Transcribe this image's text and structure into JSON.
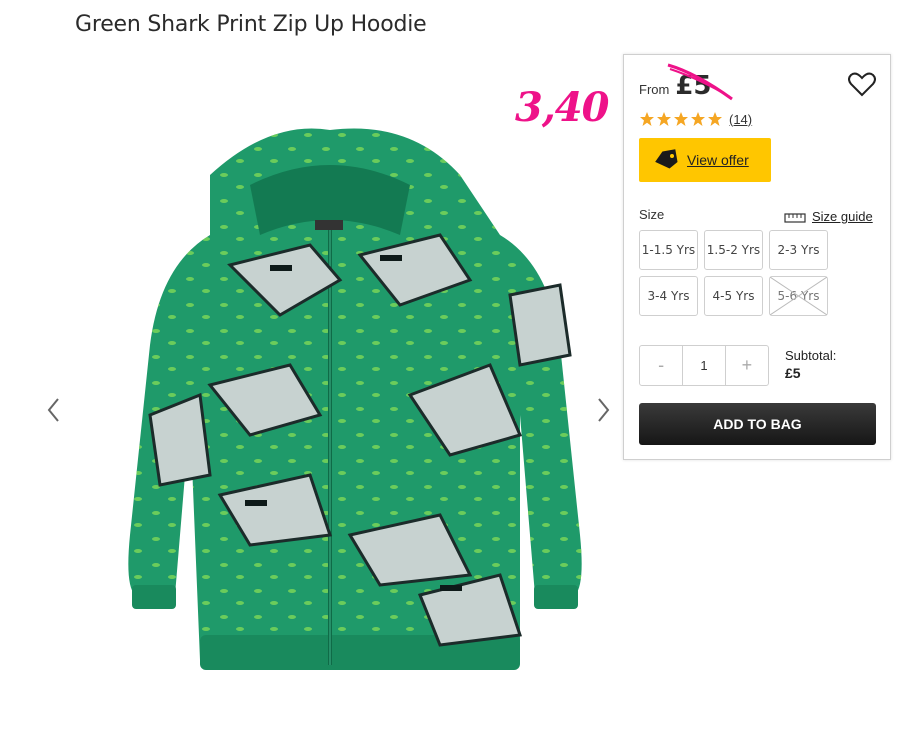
{
  "product": {
    "title": "Green Shark Print Zip Up Hoodie"
  },
  "annotation": {
    "handwritten_price": "3,40",
    "color": "#ee1289"
  },
  "pricing": {
    "from_label": "From",
    "price": "£5"
  },
  "rating": {
    "stars": 5,
    "star_color": "#f5a623",
    "reviews": "(14)"
  },
  "offer": {
    "label": "View offer",
    "color": "#ffc600"
  },
  "size": {
    "label": "Size",
    "guide_label": "Size guide",
    "options": [
      {
        "label": "1-1.5 Yrs",
        "available": true
      },
      {
        "label": "1.5-2 Yrs",
        "available": true
      },
      {
        "label": "2-3 Yrs",
        "available": true
      },
      {
        "label": "3-4 Yrs",
        "available": true
      },
      {
        "label": "4-5 Yrs",
        "available": true
      },
      {
        "label": "5-6 Yrs",
        "available": false
      }
    ]
  },
  "quantity": {
    "minus": "-",
    "value": "1",
    "plus": "+"
  },
  "subtotal": {
    "label": "Subtotal:",
    "value": "£5"
  },
  "cart": {
    "add_label": "ADD TO BAG"
  },
  "icons": {
    "prev": "chevron-left-icon",
    "next": "chevron-right-icon",
    "wishlist": "heart-icon",
    "offer": "tag-icon",
    "size_guide": "ruler-icon"
  }
}
